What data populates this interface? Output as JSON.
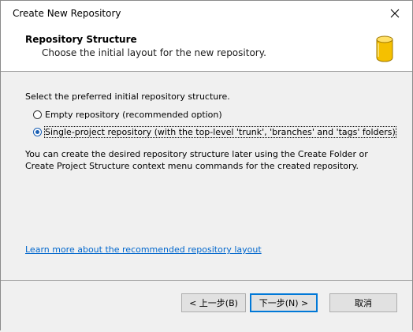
{
  "window": {
    "title": "Create New Repository"
  },
  "header": {
    "title": "Repository Structure",
    "subtitle": "Choose the initial layout for the new repository.",
    "icon": "database-icon"
  },
  "body": {
    "prompt": "Select the preferred initial repository structure.",
    "options": [
      {
        "label": "Empty repository (recommended option)",
        "selected": false
      },
      {
        "label": "Single-project repository (with the top-level 'trunk', 'branches' and 'tags' folders)",
        "selected": true
      }
    ],
    "info": "You can create the desired repository structure later using the Create Folder or Create Project Structure context menu commands for the created repository.",
    "link": "Learn more about the recommended repository layout"
  },
  "buttons": {
    "back": "< 上一步(B)",
    "next": "下一步(N) >",
    "cancel": "取消"
  },
  "colors": {
    "accent": "#0078d7",
    "link": "#0066cc",
    "icon": "#f5c000"
  }
}
